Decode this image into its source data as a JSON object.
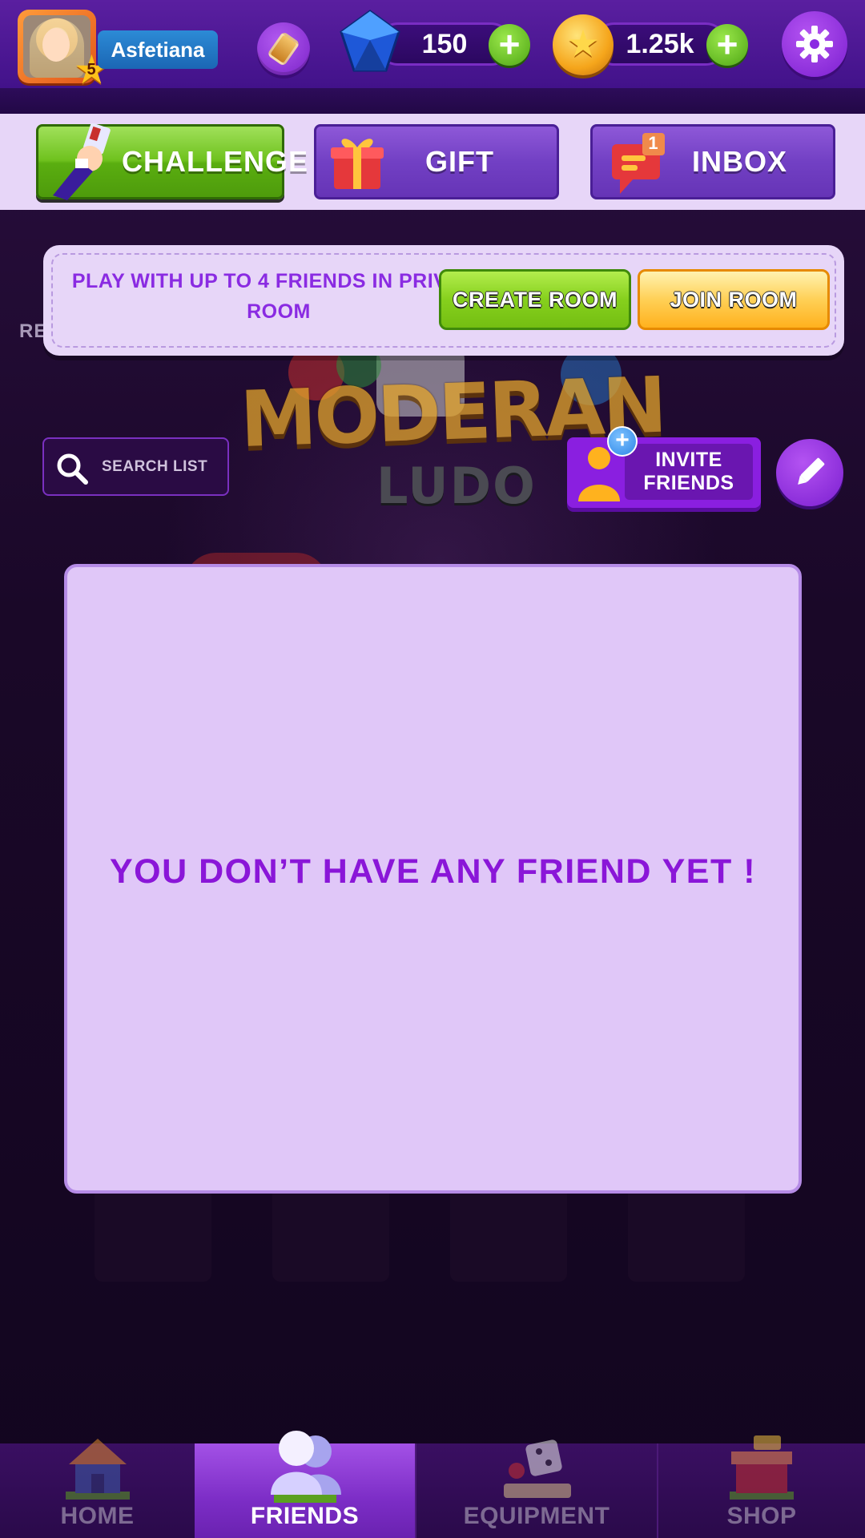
{
  "header": {
    "username": "Asfetiana",
    "level": "5",
    "gems": "150",
    "coins": "1.25k"
  },
  "actions": {
    "challenge": "CHALLENGE",
    "gift": "GIFT",
    "inbox": "INBOX",
    "inbox_badge": "1"
  },
  "private_room": {
    "description": "PLAY WITH UP TO 4 FRIENDS IN PRIVATE ROOM",
    "create_label": "CREATE ROOM",
    "join_label": "JOIN ROOM"
  },
  "background": {
    "partial_label": "RE",
    "logo_title": "MODERAN",
    "logo_subtitle": "LUDO"
  },
  "search": {
    "placeholder": "SEARCH LIST"
  },
  "invite": {
    "label": "INVITE FRIENDS"
  },
  "friends": {
    "empty_message": "YOU DON’T HAVE ANY FRIEND YET !"
  },
  "nav": {
    "items": [
      {
        "label": "HOME",
        "icon": "house-icon"
      },
      {
        "label": "FRIENDS",
        "icon": "friends-icon",
        "active": true
      },
      {
        "label": "EQUIPMENT",
        "icon": "dice-icon"
      },
      {
        "label": "SHOP",
        "icon": "shop-icon"
      }
    ]
  },
  "colors": {
    "accent_purple": "#8a16d8",
    "panel_lavender": "#e0c7f8",
    "green": "#6fc21e",
    "gold": "#ffd056"
  }
}
